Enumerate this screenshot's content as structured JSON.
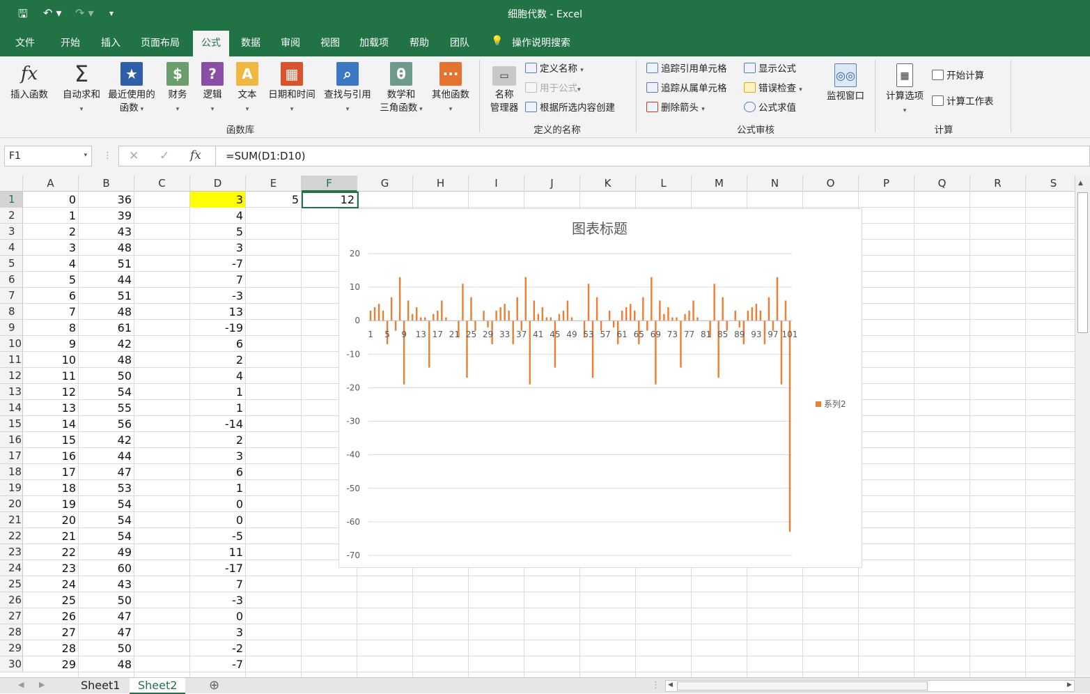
{
  "app": {
    "title": "细胞代数  -  Excel"
  },
  "tabs": [
    "文件",
    "开始",
    "插入",
    "页面布局",
    "公式",
    "数据",
    "审阅",
    "视图",
    "加载项",
    "帮助",
    "团队",
    "操作说明搜索"
  ],
  "ribbon": {
    "insert_function": "插入函数",
    "autosum": "自动求和",
    "recent": [
      "最近使用的",
      "函数"
    ],
    "financial": "财务",
    "logical": "逻辑",
    "text": "文本",
    "datetime": "日期和时间",
    "lookup": "查找与引用",
    "math": [
      "数学和",
      "三角函数"
    ],
    "more": "其他函数",
    "group_library": "函数库",
    "name_manager": [
      "名称",
      "管理器"
    ],
    "define_name": "定义名称",
    "use_in_formula": "用于公式",
    "create_from_selection": "根据所选内容创建",
    "group_names": "定义的名称",
    "trace_precedents": "追踪引用单元格",
    "trace_dependents": "追踪从属单元格",
    "remove_arrows": "删除箭头",
    "show_formulas": "显示公式",
    "error_checking": "错误检查",
    "evaluate_formula": "公式求值",
    "watch_window": "监视窗口",
    "group_auditing": "公式审核",
    "calc_options": "计算选项",
    "calc_now": "开始计算",
    "calc_sheet": "计算工作表",
    "group_calc": "计算"
  },
  "formula_bar": {
    "name_box": "F1",
    "formula": "=SUM(D1:D10)",
    "fx": "fx"
  },
  "columns": [
    "A",
    "B",
    "C",
    "D",
    "E",
    "F",
    "G",
    "H",
    "I",
    "J",
    "K",
    "L",
    "M",
    "N",
    "O",
    "P",
    "Q",
    "R",
    "S"
  ],
  "rows": [
    {
      "n": "1",
      "a": "0",
      "b": "36",
      "d": "3",
      "e": "5",
      "f": "12"
    },
    {
      "n": "2",
      "a": "1",
      "b": "39",
      "d": "4"
    },
    {
      "n": "3",
      "a": "2",
      "b": "43",
      "d": "5"
    },
    {
      "n": "4",
      "a": "3",
      "b": "48",
      "d": "3"
    },
    {
      "n": "5",
      "a": "4",
      "b": "51",
      "d": "-7"
    },
    {
      "n": "6",
      "a": "5",
      "b": "44",
      "d": "7"
    },
    {
      "n": "7",
      "a": "6",
      "b": "51",
      "d": "-3"
    },
    {
      "n": "8",
      "a": "7",
      "b": "48",
      "d": "13"
    },
    {
      "n": "9",
      "a": "8",
      "b": "61",
      "d": "-19"
    },
    {
      "n": "10",
      "a": "9",
      "b": "42",
      "d": "6"
    },
    {
      "n": "11",
      "a": "10",
      "b": "48",
      "d": "2"
    },
    {
      "n": "12",
      "a": "11",
      "b": "50",
      "d": "4"
    },
    {
      "n": "13",
      "a": "12",
      "b": "54",
      "d": "1"
    },
    {
      "n": "14",
      "a": "13",
      "b": "55",
      "d": "1"
    },
    {
      "n": "15",
      "a": "14",
      "b": "56",
      "d": "-14"
    },
    {
      "n": "16",
      "a": "15",
      "b": "42",
      "d": "2"
    },
    {
      "n": "17",
      "a": "16",
      "b": "44",
      "d": "3"
    },
    {
      "n": "18",
      "a": "17",
      "b": "47",
      "d": "6"
    },
    {
      "n": "19",
      "a": "18",
      "b": "53",
      "d": "1"
    },
    {
      "n": "20",
      "a": "19",
      "b": "54",
      "d": "0"
    },
    {
      "n": "21",
      "a": "20",
      "b": "54",
      "d": "0"
    },
    {
      "n": "22",
      "a": "21",
      "b": "54",
      "d": "-5"
    },
    {
      "n": "23",
      "a": "22",
      "b": "49",
      "d": "11"
    },
    {
      "n": "24",
      "a": "23",
      "b": "60",
      "d": "-17"
    },
    {
      "n": "25",
      "a": "24",
      "b": "43",
      "d": "7"
    },
    {
      "n": "26",
      "a": "25",
      "b": "50",
      "d": "-3"
    },
    {
      "n": "27",
      "a": "26",
      "b": "47",
      "d": "0"
    },
    {
      "n": "28",
      "a": "27",
      "b": "47",
      "d": "3"
    },
    {
      "n": "29",
      "a": "28",
      "b": "50",
      "d": "-2"
    },
    {
      "n": "30",
      "a": "29",
      "b": "48",
      "d": "-7"
    }
  ],
  "highlight_color": "#ffff00",
  "accent_color": "#217346",
  "chart_data": {
    "type": "bar",
    "title": "图表标题",
    "legend": [
      "系列2"
    ],
    "legend_position": "right",
    "color": "#ed7d31",
    "ylim": [
      -70,
      20
    ],
    "yticks": [
      "20",
      "10",
      "0",
      "-10",
      "-20",
      "-30",
      "-40",
      "-50",
      "-60",
      "-70"
    ],
    "xticks": [
      "1",
      "5",
      "9",
      "13",
      "17",
      "21",
      "25",
      "29",
      "33",
      "37",
      "41",
      "45",
      "49",
      "53",
      "57",
      "61",
      "65",
      "69",
      "73",
      "77",
      "81",
      "85",
      "89",
      "93",
      "97",
      "101"
    ],
    "values": [
      3,
      4,
      5,
      3,
      -7,
      7,
      -3,
      13,
      -19,
      6,
      2,
      4,
      1,
      1,
      -14,
      2,
      3,
      6,
      1,
      0,
      0,
      -5,
      11,
      -17,
      7,
      -3,
      0,
      3,
      -2,
      -7,
      3,
      4,
      5,
      3,
      -7,
      7,
      -3,
      13,
      -19,
      6,
      2,
      4,
      1,
      1,
      -14,
      2,
      3,
      6,
      1,
      0,
      0,
      -5,
      11,
      -17,
      7,
      -3,
      0,
      3,
      -2,
      -7,
      3,
      4,
      5,
      3,
      -7,
      7,
      -3,
      13,
      -19,
      6,
      2,
      4,
      1,
      1,
      -14,
      2,
      3,
      6,
      1,
      0,
      0,
      -5,
      11,
      -17,
      7,
      -3,
      0,
      3,
      -2,
      -7,
      3,
      4,
      5,
      3,
      -7,
      7,
      -3,
      13,
      -19,
      6,
      -63
    ]
  },
  "sheets": [
    "Sheet1",
    "Sheet2"
  ],
  "active_sheet": "Sheet2"
}
